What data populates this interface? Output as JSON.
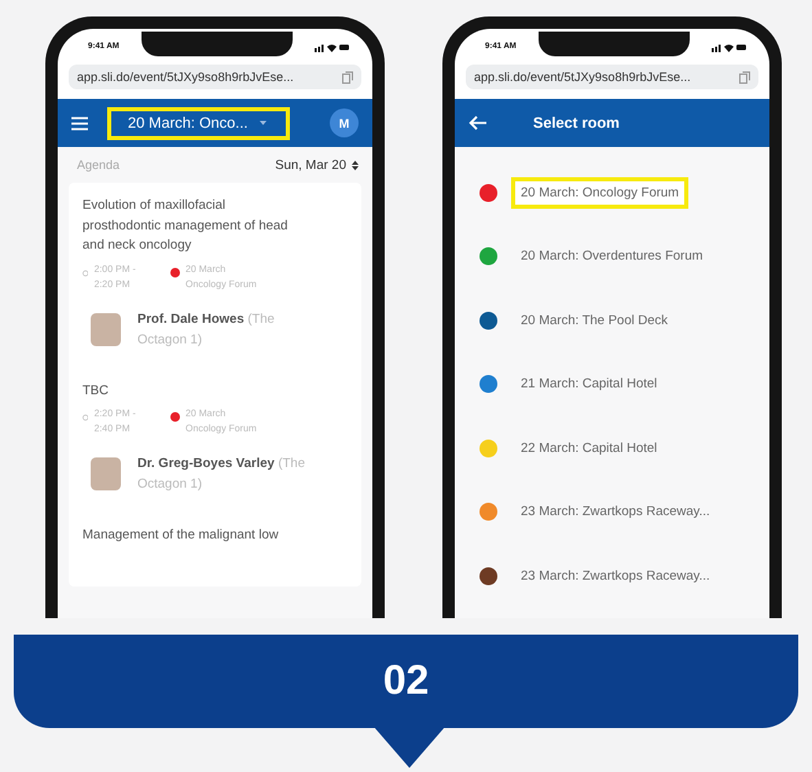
{
  "phones": [
    {
      "status_time": "9:41 AM",
      "url": "app.sli.do/event/5tJXy9so8h9rbJvEse...",
      "header": {
        "kind": "agenda",
        "room": "20 March: Onco...",
        "highlighted": true,
        "avatar": "M"
      },
      "agenda": {
        "label": "Agenda",
        "date": "Sun, Mar 20"
      },
      "sessions": [
        {
          "title": "Evolution of maxillofacial prosthodontic management of head and neck oncology",
          "time": "2:00 PM - 2:20 PM",
          "room": "20 March Oncology Forum",
          "color": "#e8202a",
          "speaker": "**Prof. Dale Howes** (The Octagon 1)"
        },
        {
          "title": "TBC",
          "time": "2:20 PM - 2:40 PM",
          "room": "20 March Oncology Forum",
          "color": "#e8202a",
          "speaker": "**Dr. Greg-Boyes Varley** (The Octagon 1)"
        },
        {
          "title": "Management of the malignant low"
        }
      ]
    },
    {
      "status_time": "9:41 AM",
      "url": "app.sli.do/event/5tJXy9so8h9rbJvEse...",
      "header": {
        "kind": "rooms",
        "title": "Select room"
      },
      "rooms": [
        {
          "name": "20 March: Oncology Forum",
          "color": "#e8202a",
          "selected": true
        },
        {
          "name": "20 March: Overdentures Forum",
          "color": "#1fa640",
          "selected": false
        },
        {
          "name": "20 March: The Pool Deck",
          "color": "#0e5a94",
          "selected": false
        },
        {
          "name": "21 March: Capital Hotel",
          "color": "#1f7fcf",
          "selected": false
        },
        {
          "name": "22 March: Capital Hotel",
          "color": "#f6cf1c",
          "selected": false
        },
        {
          "name": "23 March: Zwartkops Raceway...",
          "color": "#f08a2a",
          "selected": false
        },
        {
          "name": "23 March: Zwartkops Raceway...",
          "color": "#6e3b24",
          "selected": false
        }
      ]
    }
  ],
  "step": "02"
}
